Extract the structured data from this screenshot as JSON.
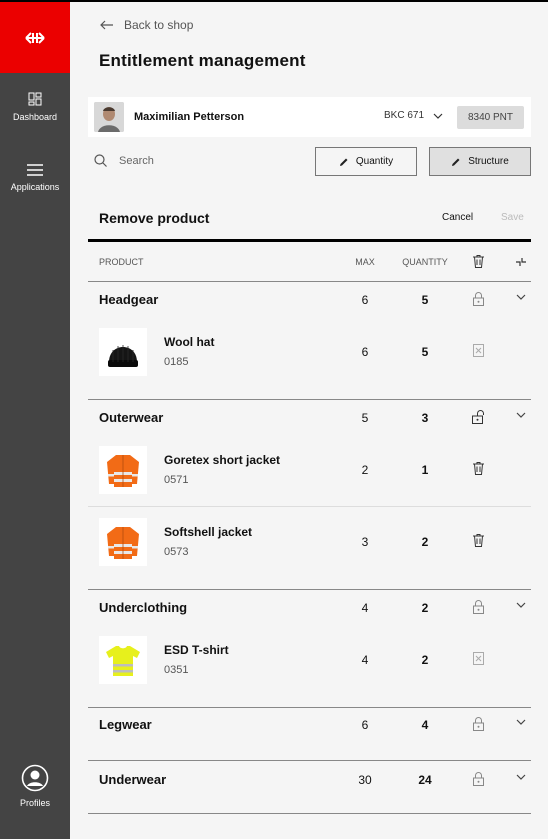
{
  "sidebar": {
    "brand_icon": "sbb-logo-icon",
    "brand_color": "#eb0000",
    "items": [
      {
        "label": "Dashboard",
        "icon": "dashboard-icon"
      },
      {
        "label": "Applications",
        "icon": "menu-icon"
      },
      {
        "label": "Profiles",
        "icon": "profile-icon"
      }
    ]
  },
  "header": {
    "back_label": "Back to shop",
    "title": "Entitlement management"
  },
  "user": {
    "name": "Maximilian Petterson",
    "group": "BKC 671",
    "points": "8340 PNT"
  },
  "toolbar": {
    "search_placeholder": "Search",
    "quantity_label": "Quantity",
    "structure_label": "Structure"
  },
  "section": {
    "title": "Remove product",
    "cancel_label": "Cancel",
    "save_label": "Save"
  },
  "table": {
    "headers": {
      "product": "PRODUCT",
      "max": "MAX",
      "quantity": "QUANTITY"
    },
    "categories": [
      {
        "name": "Headgear",
        "max": "6",
        "quantity": "5",
        "lock": "locked",
        "items": [
          {
            "name": "Wool hat",
            "code": "0185",
            "max": "6",
            "quantity": "5",
            "action": "delete-disabled",
            "image": "beanie"
          }
        ]
      },
      {
        "name": "Outerwear",
        "max": "5",
        "quantity": "3",
        "lock": "unlocked",
        "items": [
          {
            "name": "Goretex short jacket",
            "code": "0571",
            "max": "2",
            "quantity": "1",
            "action": "delete",
            "image": "jacket"
          },
          {
            "name": "Softshell jacket",
            "code": "0573",
            "max": "3",
            "quantity": "2",
            "action": "delete",
            "image": "jacket"
          }
        ]
      },
      {
        "name": "Underclothing",
        "max": "4",
        "quantity": "2",
        "lock": "locked",
        "items": [
          {
            "name": "ESD T-shirt",
            "code": "0351",
            "max": "4",
            "quantity": "2",
            "action": "delete-disabled",
            "image": "tshirt"
          }
        ]
      },
      {
        "name": "Legwear",
        "max": "6",
        "quantity": "4",
        "lock": "locked",
        "items": []
      },
      {
        "name": "Underwear",
        "max": "30",
        "quantity": "24",
        "lock": "locked",
        "items": []
      }
    ]
  }
}
